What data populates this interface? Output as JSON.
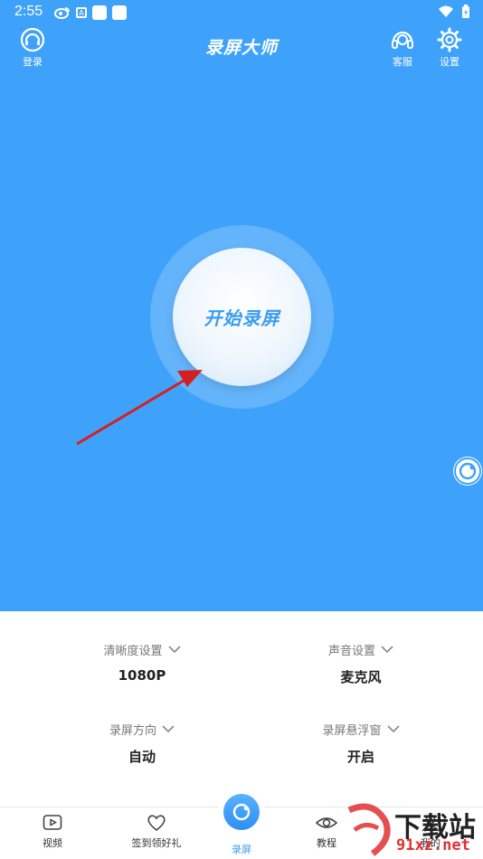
{
  "status_bar": {
    "time": "2:55",
    "a_badge": "A"
  },
  "header": {
    "login_label": "登录",
    "title": "录屏大师",
    "service_label": "客服",
    "settings_label": "设置"
  },
  "record_button": {
    "label": "开始录屏"
  },
  "settings": {
    "quality": {
      "title": "清晰度设置",
      "value": "1080P"
    },
    "audio": {
      "title": "声音设置",
      "value": "麦克风"
    },
    "orientation": {
      "title": "录屏方向",
      "value": "自动"
    },
    "floating_window": {
      "title": "录屏悬浮窗",
      "value": "开启"
    }
  },
  "bottom_nav": {
    "video": "视频",
    "checkin": "签到领好礼",
    "record": "录屏",
    "tutorial": "教程",
    "mine": "我的"
  },
  "watermark": {
    "text": "下载站",
    "url": "91xz.net"
  },
  "colors": {
    "primary_blue": "#3ea2fb",
    "arrow_red": "#d42020",
    "watermark_red": "#e03030"
  }
}
